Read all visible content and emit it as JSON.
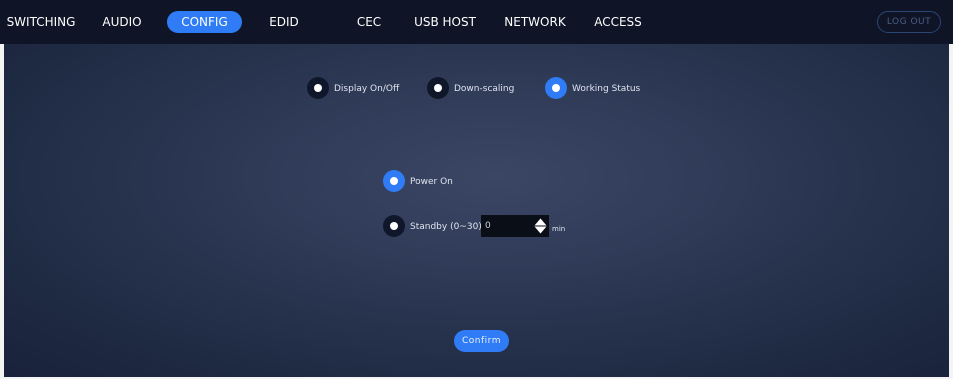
{
  "nav": {
    "items": [
      {
        "label": "SWITCHING"
      },
      {
        "label": "AUDIO"
      },
      {
        "label": "CONFIG"
      },
      {
        "label": "EDID"
      },
      {
        "label": "CEC"
      },
      {
        "label": "USB HOST"
      },
      {
        "label": "NETWORK"
      },
      {
        "label": "ACCESS"
      }
    ],
    "active": "CONFIG",
    "logout_label": "LOG OUT"
  },
  "config": {
    "modes": [
      {
        "label": "Display On/Off",
        "selected": false
      },
      {
        "label": "Down-scaling",
        "selected": false
      },
      {
        "label": "Working Status",
        "selected": true
      }
    ],
    "options": {
      "power_on": {
        "label": "Power On",
        "selected": true
      },
      "standby": {
        "label": "Standby (0~30)",
        "selected": false,
        "value": "0",
        "unit": "min"
      }
    },
    "confirm_label": "Confirm"
  },
  "colors": {
    "accent": "#2f7cf6",
    "navbar": "#0f1426",
    "panel": "#2e3a56"
  },
  "icons": {
    "radio_checked": "radio-checked-icon",
    "radio_unchecked": "radio-unchecked-icon",
    "stepper": "up-down-arrows-icon"
  }
}
